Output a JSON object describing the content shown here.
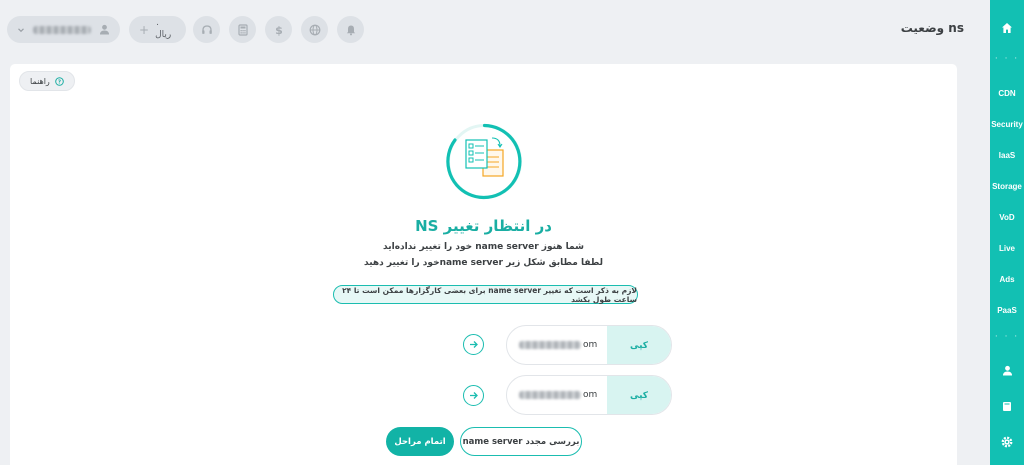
{
  "page": {
    "title": "وضعیت ns"
  },
  "sidebar": {
    "items": [
      "CDN",
      "Security",
      "IaaS",
      "Storage",
      "VoD",
      "Live",
      "Ads",
      "PaaS"
    ],
    "dots": "· · ·"
  },
  "topbar": {
    "balance_label": "۰ ریال",
    "plus": "+"
  },
  "card": {
    "guide_label": "راهنما",
    "status_title": "در انتظار تغییر NS",
    "line1": "شما هنوز name server خود را تغییر نداده‌اید",
    "line2": "لطفا مطابق شکل زیر name serverخود را تغییر دهید",
    "notice": "لازم به ذکر است که تغییر name server برای بعضی کارگزارها ممکن است تا ۲۴ ساعت طول بکشد",
    "ns_rows": [
      {
        "value_suffix": "om",
        "copy_label": "کپی"
      },
      {
        "value_suffix": "om",
        "copy_label": "کپی"
      }
    ],
    "recheck_label": "بررسی مجدد name server",
    "finish_label": "اتمام مراحل"
  },
  "colors": {
    "accent": "#12c0b3",
    "accent_dark": "#12b3a6",
    "light_accent": "#d8f4f1",
    "orange": "#f5a623"
  }
}
